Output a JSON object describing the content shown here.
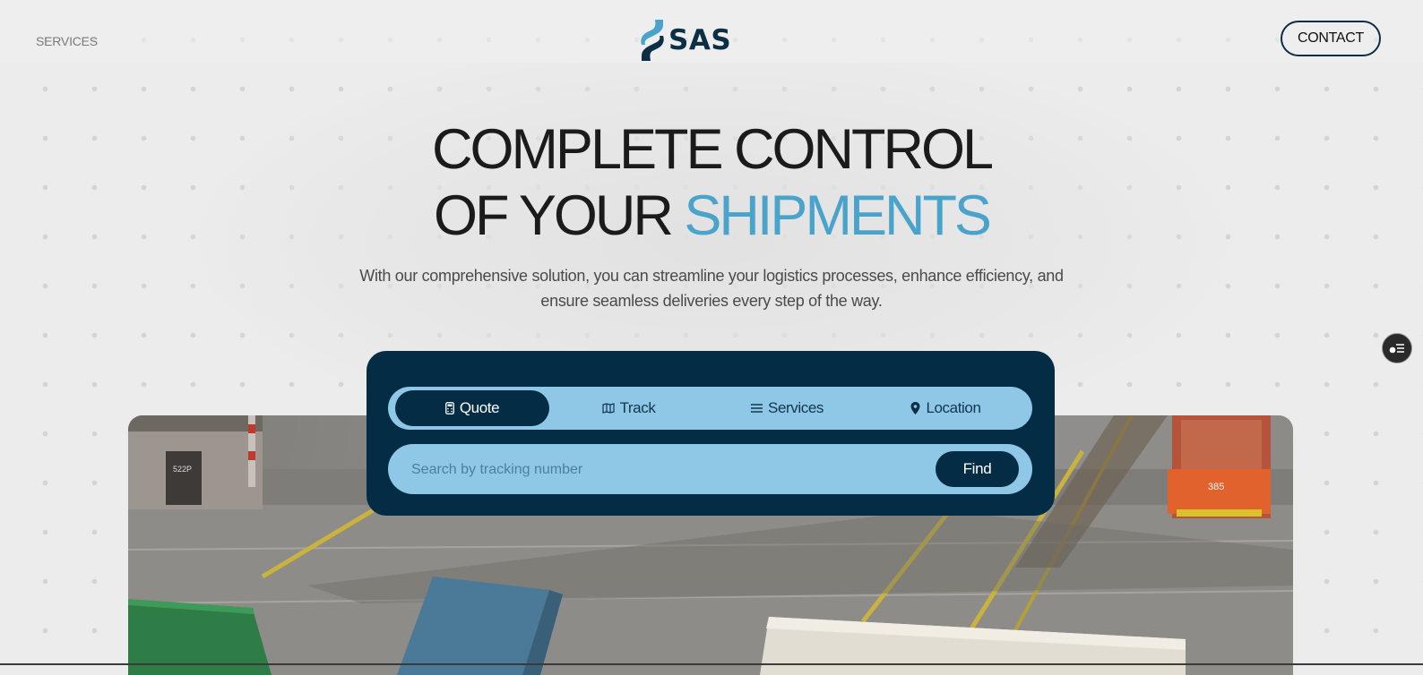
{
  "header": {
    "nav_services": "SERVICES",
    "logo_text": "SAS",
    "contact_label": "CONTACT"
  },
  "hero": {
    "headline_line1": "COMPLETE CONTROL",
    "headline_line2_prefix": "OF YOUR ",
    "headline_line2_accent": "SHIPMENTS",
    "subtitle": "With our comprehensive solution, you can streamline your logistics processes, enhance efficiency, and ensure seamless deliveries every step of the way."
  },
  "widget": {
    "tabs": [
      {
        "label": "Quote",
        "icon": "calculator-icon",
        "active": true
      },
      {
        "label": "Track",
        "icon": "map-icon",
        "active": false
      },
      {
        "label": "Services",
        "icon": "list-icon",
        "active": false
      },
      {
        "label": "Location",
        "icon": "pin-icon",
        "active": false
      }
    ],
    "search_placeholder": "Search by tracking number",
    "search_value": "",
    "find_label": "Find"
  },
  "photo": {
    "building_label": "522P",
    "vehicle_number": "385"
  },
  "colors": {
    "brand_navy": "#052c45",
    "accent_blue": "#4aa3cb",
    "pill_blue": "#8ec8e6"
  },
  "floating_button_icon": "toggle-list-icon"
}
